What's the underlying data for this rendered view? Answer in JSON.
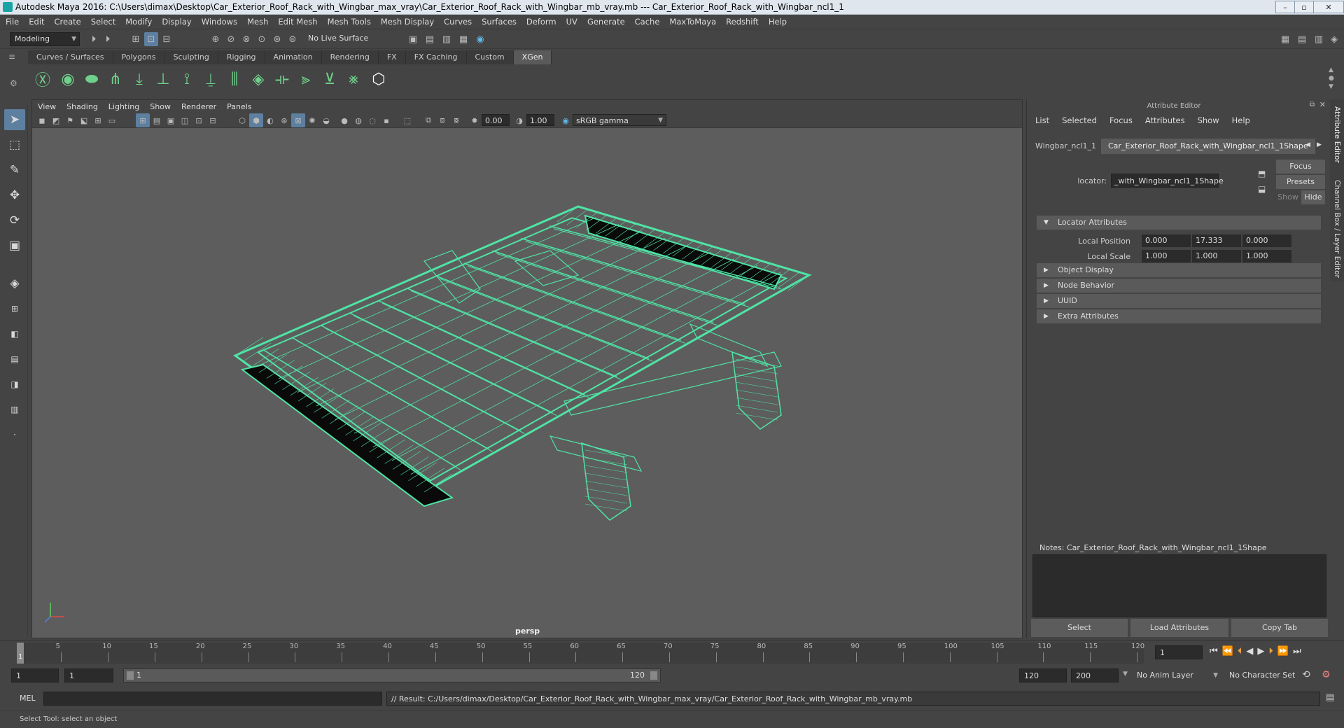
{
  "window": {
    "title": "Autodesk Maya 2016: C:\\Users\\dimax\\Desktop\\Car_Exterior_Roof_Rack_with_Wingbar_max_vray\\Car_Exterior_Roof_Rack_with_Wingbar_mb_vray.mb  ---  Car_Exterior_Roof_Rack_with_Wingbar_ncl1_1"
  },
  "menubar": [
    "File",
    "Edit",
    "Create",
    "Select",
    "Modify",
    "Display",
    "Windows",
    "Mesh",
    "Edit Mesh",
    "Mesh Tools",
    "Mesh Display",
    "Curves",
    "Surfaces",
    "Deform",
    "UV",
    "Generate",
    "Cache",
    "MaxToMaya",
    "Redshift",
    "Help"
  ],
  "statusline": {
    "mode": "Modeling",
    "live_surface": "No Live Surface"
  },
  "shelf": {
    "tabs": [
      "Curves / Surfaces",
      "Polygons",
      "Sculpting",
      "Rigging",
      "Animation",
      "Rendering",
      "FX",
      "FX Caching",
      "Custom",
      "XGen"
    ],
    "active_tab": "XGen"
  },
  "viewport": {
    "menu": [
      "View",
      "Shading",
      "Lighting",
      "Show",
      "Renderer",
      "Panels"
    ],
    "exposure": "0.00",
    "gamma": "1.00",
    "color_space": "sRGB gamma",
    "camera": "persp",
    "wire_color": "#4fe3a5"
  },
  "attribute_editor": {
    "title": "Attribute Editor",
    "menu": [
      "List",
      "Selected",
      "Focus",
      "Attributes",
      "Show",
      "Help"
    ],
    "tabs": [
      "Wingbar_ncl1_1",
      "Car_Exterior_Roof_Rack_with_Wingbar_ncl1_1Shape"
    ],
    "focus_label": "Focus",
    "presets_label": "Presets",
    "show_label": "Show",
    "hide_label": "Hide",
    "type_label": "locator:",
    "node_name": "_with_Wingbar_ncl1_1Shape",
    "sections": {
      "locator": "Locator Attributes",
      "object_display": "Object Display",
      "node_behavior": "Node Behavior",
      "uuid": "UUID",
      "extra": "Extra Attributes"
    },
    "local_position": {
      "label": "Local Position",
      "x": "0.000",
      "y": "17.333",
      "z": "0.000"
    },
    "local_scale": {
      "label": "Local Scale",
      "x": "1.000",
      "y": "1.000",
      "z": "1.000"
    },
    "notes": "Notes:  Car_Exterior_Roof_Rack_with_Wingbar_ncl1_1Shape",
    "buttons": {
      "select": "Select",
      "load": "Load Attributes",
      "copy": "Copy Tab"
    }
  },
  "side_tabs": [
    "Attribute Editor",
    "Channel Box / Layer Editor"
  ],
  "timeline": {
    "ticks": [
      "5",
      "10",
      "15",
      "20",
      "25",
      "30",
      "35",
      "40",
      "45",
      "50",
      "55",
      "60",
      "65",
      "70",
      "75",
      "80",
      "85",
      "90",
      "95",
      "100",
      "105",
      "110",
      "115",
      "120"
    ],
    "start_label": "1",
    "current_frame": "1"
  },
  "range": {
    "start": "1",
    "playback_start": "1",
    "slider_start": "1",
    "slider_end": "120",
    "playback_end": "120",
    "end": "200",
    "anim_layer": "No Anim Layer",
    "character_set": "No Character Set"
  },
  "cmdline": {
    "lang": "MEL",
    "result": "// Result: C:/Users/dimax/Desktop/Car_Exterior_Roof_Rack_with_Wingbar_max_vray/Car_Exterior_Roof_Rack_with_Wingbar_mb_vray.mb"
  },
  "helpline": "Select Tool: select an object"
}
